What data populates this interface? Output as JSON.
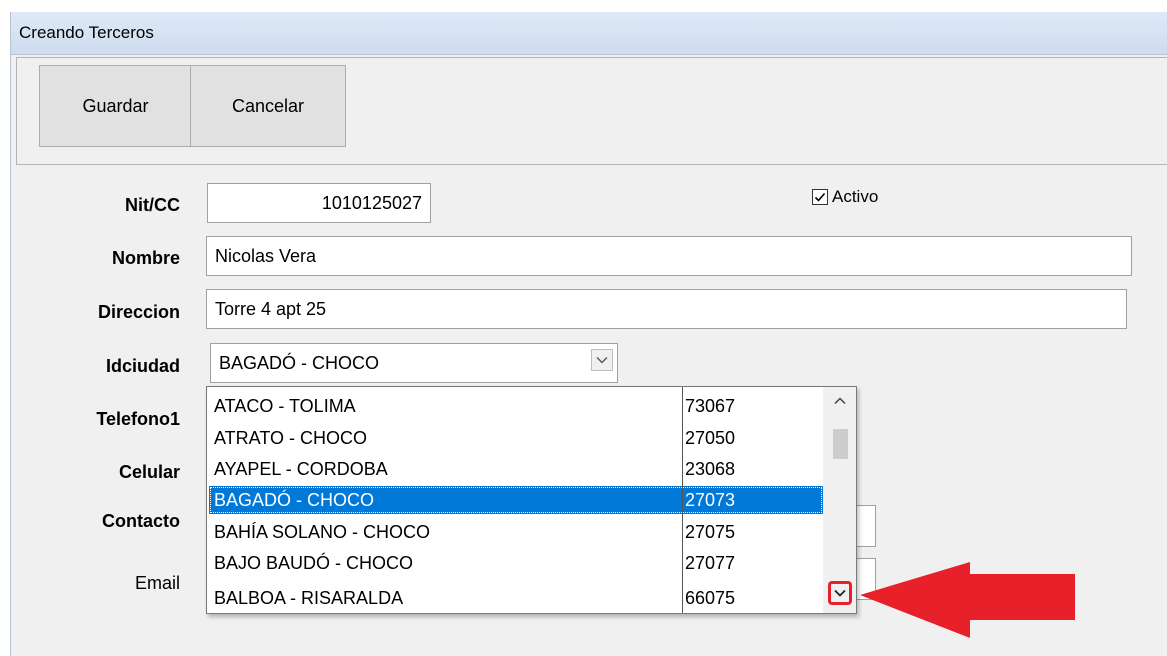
{
  "window": {
    "title": "Creando Terceros"
  },
  "toolbar": {
    "save_label": "Guardar",
    "cancel_label": "Cancelar"
  },
  "form": {
    "nit_label": "Nit/CC",
    "nit_value": "1010125027",
    "activo_label": "Activo",
    "activo_checked": true,
    "nombre_label": "Nombre",
    "nombre_value": "Nicolas Vera",
    "direccion_label": "Direccion",
    "direccion_value": "Torre 4 apt 25",
    "idciudad_label": "Idciudad",
    "idciudad_value": "BAGADÓ - CHOCO",
    "telefono1_label": "Telefono1",
    "celular_label": "Celular",
    "contacto_label": "Contacto",
    "email_label": "Email"
  },
  "dropdown": {
    "items": [
      {
        "name": "ATACO - TOLIMA",
        "code": "73067"
      },
      {
        "name": "ATRATO - CHOCO",
        "code": "27050"
      },
      {
        "name": "AYAPEL - CORDOBA",
        "code": "23068"
      },
      {
        "name": "BAGADÓ - CHOCO",
        "code": "27073"
      },
      {
        "name": "BAHÍA SOLANO - CHOCO",
        "code": "27075"
      },
      {
        "name": "BAJO BAUDÓ - CHOCO",
        "code": "27077"
      },
      {
        "name": "BALBOA - RISARALDA",
        "code": "66075"
      }
    ],
    "selected_index": 3
  },
  "colors": {
    "selection": "#0078d7",
    "annotation": "#e8202a",
    "titlebar": "#dfe9f7"
  },
  "icons": [
    "check-icon",
    "chevron-down-icon",
    "chevron-up-icon",
    "red-arrow-annotation"
  ]
}
